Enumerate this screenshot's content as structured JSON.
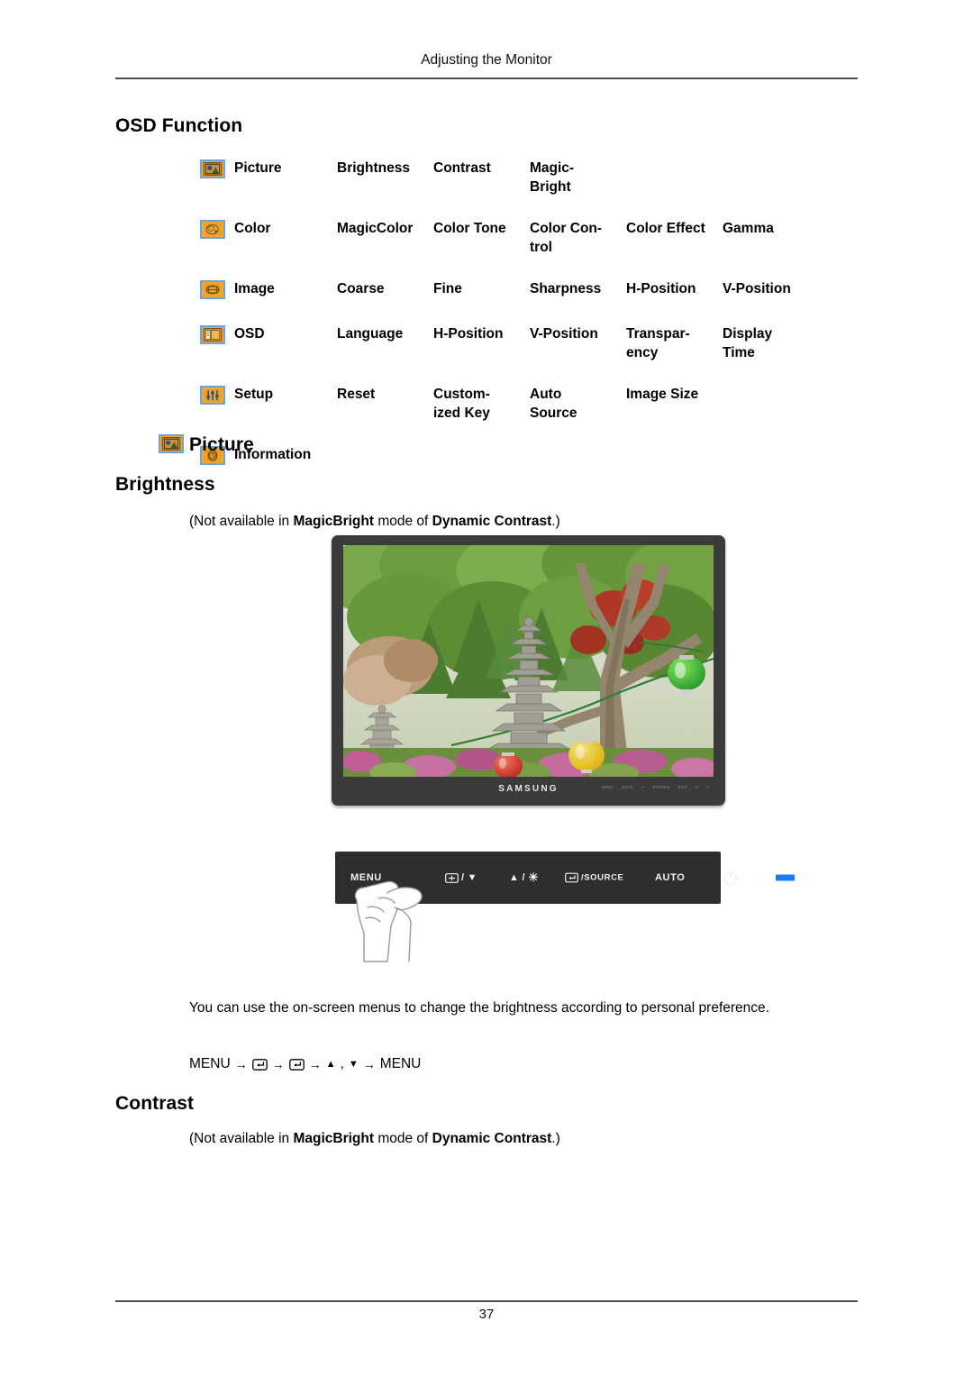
{
  "header": {
    "title": "Adjusting the Monitor"
  },
  "sections": {
    "osd_function_title": "OSD Function",
    "picture_title": "Picture",
    "brightness_title": "Brightness",
    "contrast_title": "Contrast"
  },
  "osd_table": {
    "rows": [
      {
        "icon": "picture-icon",
        "category": "Picture",
        "items": [
          "Brightness",
          "Contrast",
          "Magic-\nBright",
          "",
          ""
        ]
      },
      {
        "icon": "color-icon",
        "category": "Color",
        "items": [
          "MagicColor",
          "Color Tone",
          "Color  Con-\ntrol",
          "Color Effect",
          "Gamma"
        ]
      },
      {
        "icon": "image-icon",
        "category": "Image",
        "items": [
          "Coarse",
          "Fine",
          "Sharpness",
          "H-Position",
          "V-Position"
        ]
      },
      {
        "icon": "osd-icon",
        "category": "OSD",
        "items": [
          "Language",
          "H-Position",
          "V-Position",
          "Transpar-\nency",
          "Display\nTime"
        ]
      },
      {
        "icon": "setup-icon",
        "category": "Setup",
        "items": [
          "Reset",
          "Custom-\nized Key",
          "Auto\nSource",
          "Image Size",
          ""
        ]
      },
      {
        "icon": "information-icon",
        "category": "Information",
        "items": [
          "",
          "",
          "",
          "",
          ""
        ]
      }
    ]
  },
  "brightness": {
    "note_prefix": "(Not available in ",
    "note_bold1": "MagicBright",
    "note_mid": "  mode of ",
    "note_bold2": "Dynamic Contrast",
    "note_suffix": ".)",
    "paragraph": "You can use the on-screen menus to change the brightness according to personal preference.",
    "menu_path": {
      "start": "MENU",
      "arrow": "→",
      "enter_label": "enter-key-icon",
      "up_glyph": "▲",
      "comma": ",",
      "down_glyph": "▼",
      "end": "MENU"
    }
  },
  "contrast": {
    "note_prefix": "(Not available in ",
    "note_bold1": "MagicBright",
    "note_mid": " mode of ",
    "note_bold2": "Dynamic Contrast",
    "note_suffix": ".)"
  },
  "monitor": {
    "brand": "SAMSUNG",
    "bezel_buttons": [
      "MENU",
      "AUTO",
      "☀",
      "SOURCE",
      "EXIT",
      "⏻",
      "•"
    ],
    "screen_description": "photograph of a stone pagoda in a green garden with red and yellow lanterns"
  },
  "control_panel": {
    "menu_label": "MENU",
    "down_label": "/",
    "down_glyph": "▼",
    "up_label": "/",
    "up_glyph": "▲",
    "brightness_glyph": "☀",
    "source_label": "/SOURCE",
    "auto_label": "AUTO",
    "power_label": "power-icon",
    "led_label": "power-led-indicator"
  },
  "footer": {
    "page_number": "37"
  },
  "colors": {
    "icon_fill": "#f5a636",
    "icon_border": "#6ba4d8",
    "panel_bg": "#2e2e2e",
    "led_blue": "#1d7bf0",
    "rule": "#4d4d4d"
  }
}
